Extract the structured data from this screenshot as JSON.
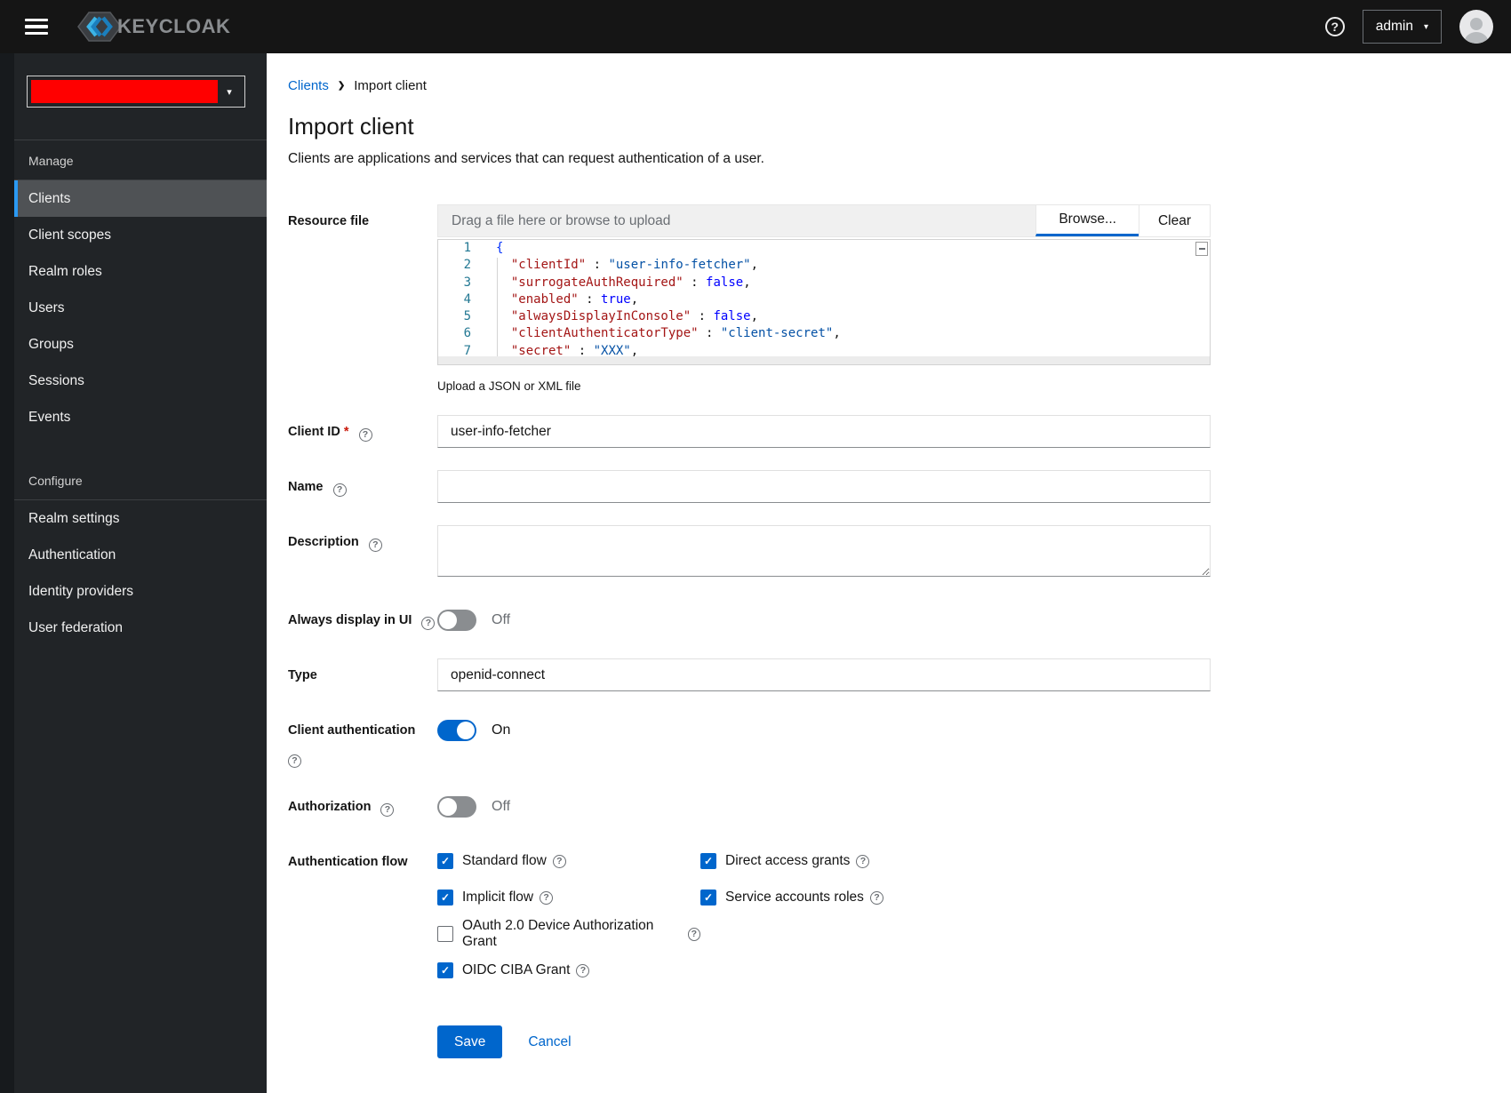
{
  "topbar": {
    "brand": "KEYCLOAK",
    "user_menu": {
      "label": "admin"
    }
  },
  "icons": {
    "menu": "hamburger",
    "help": "?",
    "caret_down": "▾",
    "breadcrumb_chevron": "❯",
    "avatar": "user-silhouette",
    "check": "✓"
  },
  "sidebar": {
    "realm_selector": {
      "redacted_color": "#ff0000"
    },
    "sections": [
      {
        "label": "Manage",
        "items": [
          {
            "label": "Clients",
            "selected": true
          },
          {
            "label": "Client scopes",
            "selected": false
          },
          {
            "label": "Realm roles",
            "selected": false
          },
          {
            "label": "Users",
            "selected": false
          },
          {
            "label": "Groups",
            "selected": false
          },
          {
            "label": "Sessions",
            "selected": false
          },
          {
            "label": "Events",
            "selected": false
          }
        ]
      },
      {
        "label": "Configure",
        "items": [
          {
            "label": "Realm settings",
            "selected": false
          },
          {
            "label": "Authentication",
            "selected": false
          },
          {
            "label": "Identity providers",
            "selected": false
          },
          {
            "label": "User federation",
            "selected": false
          }
        ]
      }
    ]
  },
  "breadcrumb": {
    "parent": "Clients",
    "current": "Import client"
  },
  "header": {
    "title": "Import client",
    "subtitle": "Clients are applications and services that can request authentication of a user."
  },
  "form": {
    "resource_file": {
      "label": "Resource file",
      "placeholder": "Drag a file here or browse to upload",
      "browse_label": "Browse...",
      "clear_label": "Clear",
      "helper": "Upload a JSON or XML file",
      "editor_lines": [
        {
          "num": "1",
          "tokens": [
            [
              "brace",
              "{"
            ]
          ]
        },
        {
          "num": "2",
          "tokens": [
            [
              "punct",
              "  "
            ],
            [
              "key",
              "\"clientId\""
            ],
            [
              "punct",
              " : "
            ],
            [
              "str",
              "\"user-info-fetcher\""
            ],
            [
              "punct",
              ","
            ]
          ]
        },
        {
          "num": "3",
          "tokens": [
            [
              "punct",
              "  "
            ],
            [
              "key",
              "\"surrogateAuthRequired\""
            ],
            [
              "punct",
              " : "
            ],
            [
              "bool",
              "false"
            ],
            [
              "punct",
              ","
            ]
          ]
        },
        {
          "num": "4",
          "tokens": [
            [
              "punct",
              "  "
            ],
            [
              "key",
              "\"enabled\""
            ],
            [
              "punct",
              " : "
            ],
            [
              "bool",
              "true"
            ],
            [
              "punct",
              ","
            ]
          ]
        },
        {
          "num": "5",
          "tokens": [
            [
              "punct",
              "  "
            ],
            [
              "key",
              "\"alwaysDisplayInConsole\""
            ],
            [
              "punct",
              " : "
            ],
            [
              "bool",
              "false"
            ],
            [
              "punct",
              ","
            ]
          ]
        },
        {
          "num": "6",
          "tokens": [
            [
              "punct",
              "  "
            ],
            [
              "key",
              "\"clientAuthenticatorType\""
            ],
            [
              "punct",
              " : "
            ],
            [
              "str",
              "\"client-secret\""
            ],
            [
              "punct",
              ","
            ]
          ]
        },
        {
          "num": "7",
          "tokens": [
            [
              "punct",
              "  "
            ],
            [
              "key",
              "\"secret\""
            ],
            [
              "punct",
              " : "
            ],
            [
              "str",
              "\"XXX\""
            ],
            [
              "punct",
              ","
            ]
          ]
        }
      ]
    },
    "client_id": {
      "label": "Client ID",
      "required": "*",
      "value": "user-info-fetcher"
    },
    "name": {
      "label": "Name",
      "value": ""
    },
    "description": {
      "label": "Description",
      "value": ""
    },
    "always_display": {
      "label": "Always display in UI",
      "state": "Off",
      "on": false
    },
    "type": {
      "label": "Type",
      "value": "openid-connect"
    },
    "client_auth": {
      "label": "Client authentication",
      "state": "On",
      "on": true
    },
    "authorization": {
      "label": "Authorization",
      "state": "Off",
      "on": false
    },
    "auth_flow": {
      "label": "Authentication flow",
      "options": [
        {
          "label": "Standard flow",
          "checked": true,
          "col": 1
        },
        {
          "label": "Direct access grants",
          "checked": true,
          "col": 2
        },
        {
          "label": "Implicit flow",
          "checked": true,
          "col": 1
        },
        {
          "label": "Service accounts roles",
          "checked": true,
          "col": 2
        },
        {
          "label": "OAuth 2.0 Device Authorization Grant",
          "checked": false,
          "col": 1
        },
        {
          "label": "OIDC CIBA Grant",
          "checked": true,
          "col": 1
        }
      ]
    },
    "actions": {
      "save": "Save",
      "cancel": "Cancel"
    }
  },
  "colors": {
    "primary": "#0066cc",
    "nav_selected_indicator": "#2b9af3",
    "code_key": "#a31515",
    "code_string": "#0451a5",
    "code_bool": "#0000ff",
    "realm_redacted": "#ff0000"
  }
}
